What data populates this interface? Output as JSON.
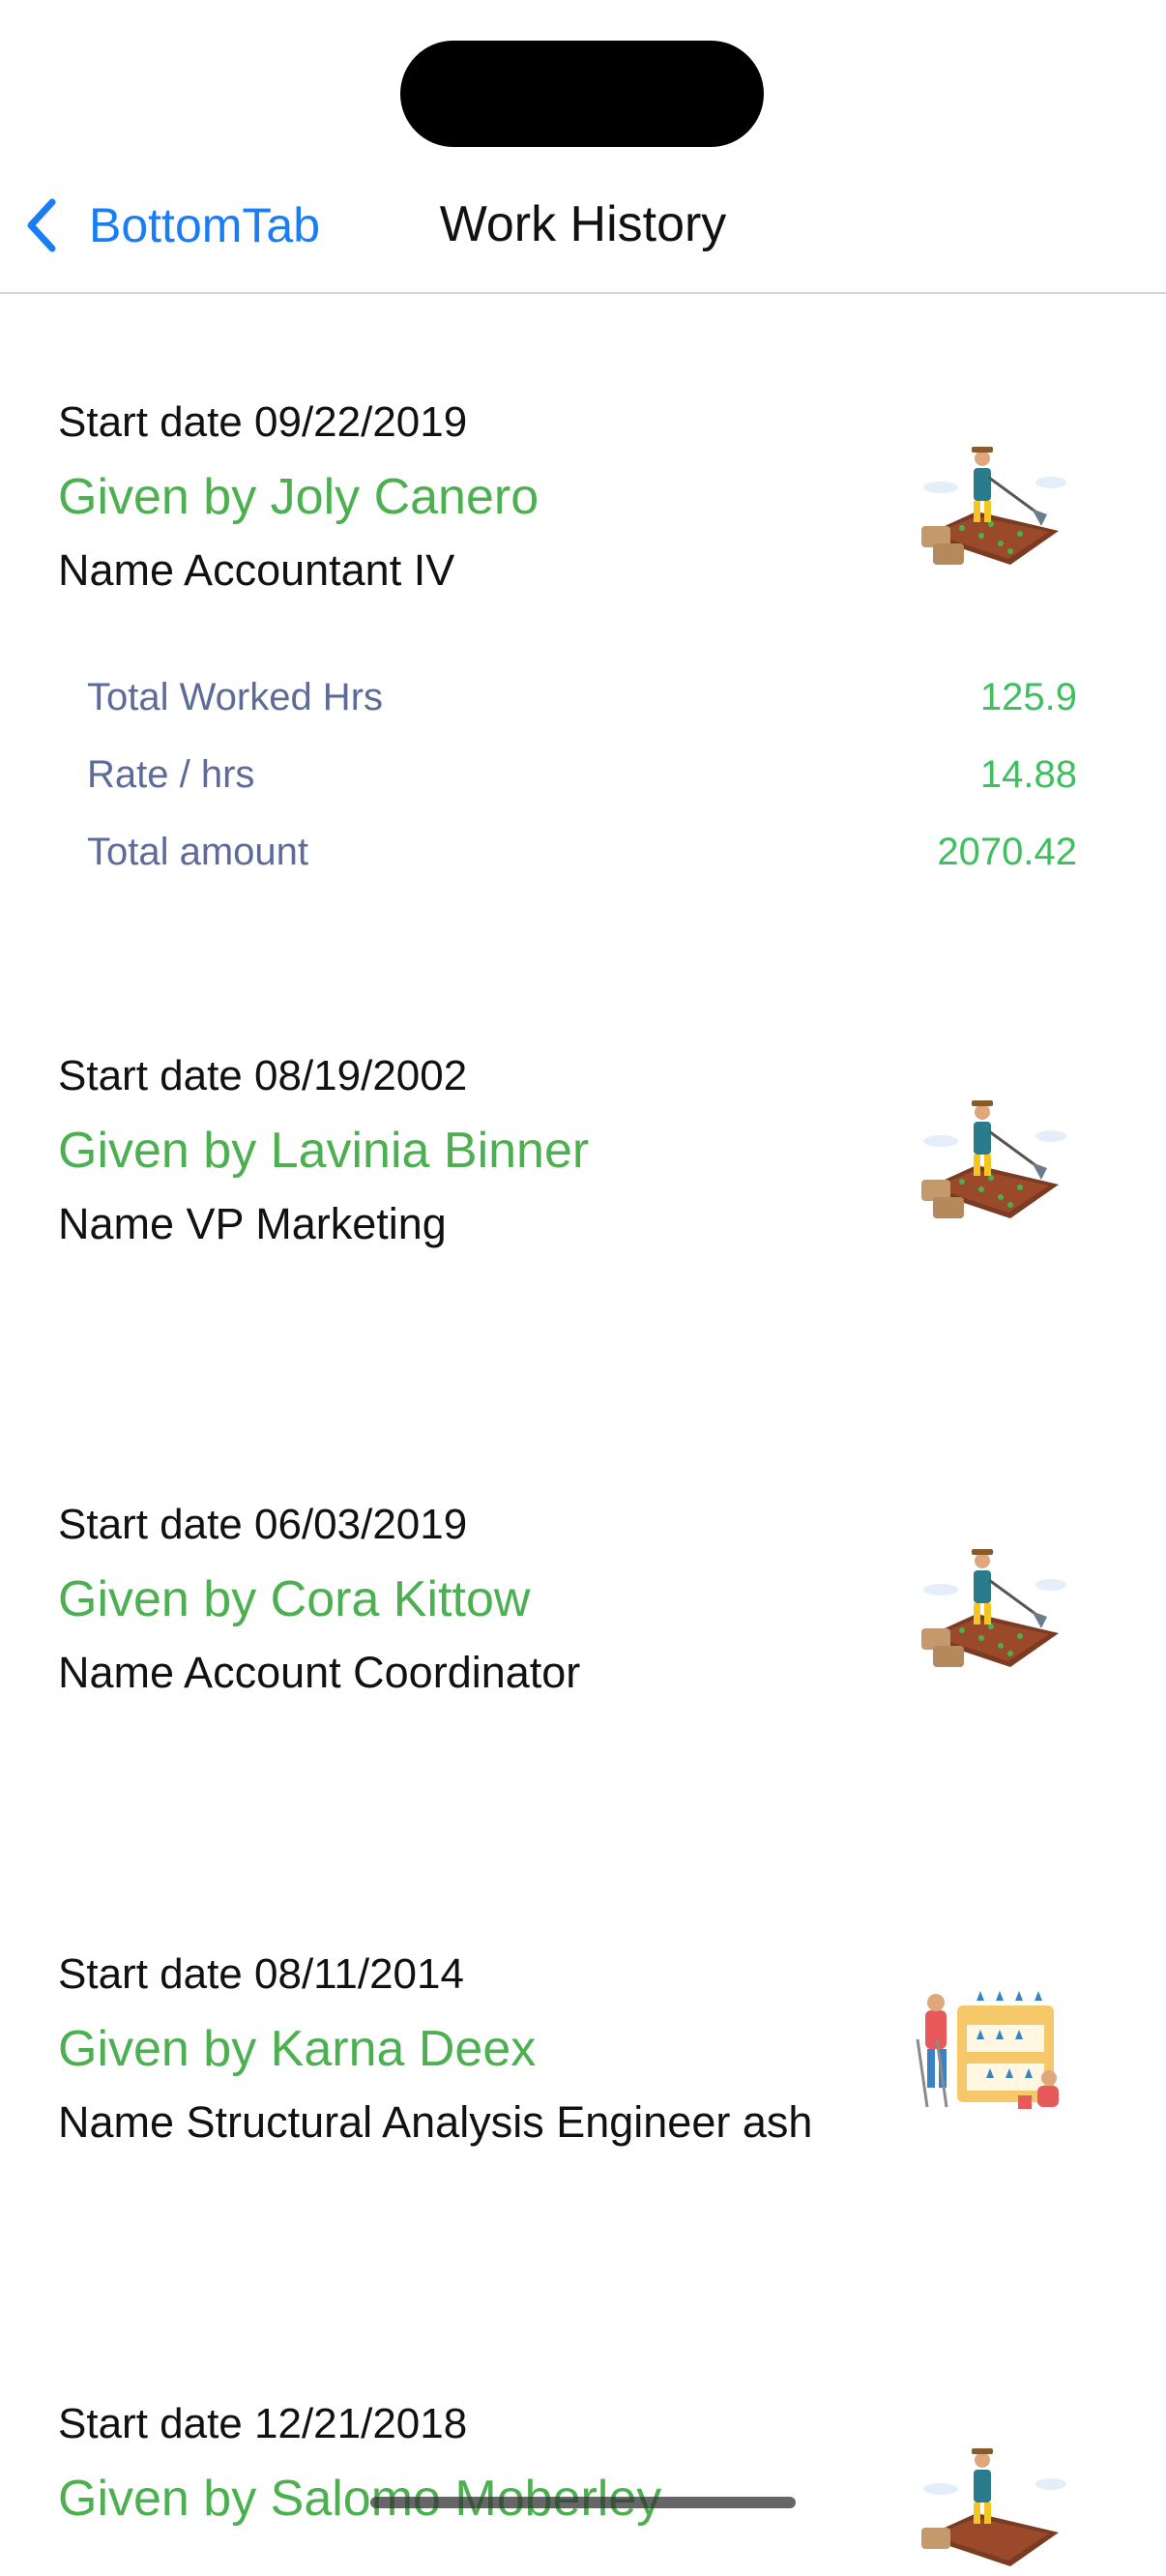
{
  "nav": {
    "back_label": "BottomTab",
    "title": "Work History"
  },
  "work_items": [
    {
      "start_date": "Start date 09/22/2019",
      "given_by": "Given by Joly Canero",
      "name": "Name Accountant IV",
      "image": "farmer-field-illustration",
      "stats": [
        {
          "label": "Total Worked Hrs",
          "value": "125.9"
        },
        {
          "label": "Rate / hrs",
          "value": "14.88"
        },
        {
          "label": "Total amount",
          "value": "2070.42"
        }
      ]
    },
    {
      "start_date": "Start date 08/19/2002",
      "given_by": "Given by Lavinia Binner",
      "name": "Name VP Marketing",
      "image": "farmer-field-illustration"
    },
    {
      "start_date": "Start date 06/03/2019",
      "given_by": "Given by Cora Kittow",
      "name": "Name Account Coordinator",
      "image": "farmer-field-illustration"
    },
    {
      "start_date": "Start date 08/11/2014",
      "given_by": "Given by Karna Deex",
      "name": "Name Structural Analysis Engineer ash",
      "image": "gardeners-shelf-illustration"
    },
    {
      "start_date": "Start date 12/21/2018",
      "given_by": "Given by Salomo Moberley",
      "name": "",
      "image": "farmer-field-illustration"
    }
  ],
  "colors": {
    "accent_blue": "#1a7ef2",
    "given_green": "#4caf50",
    "stat_label": "#5d6b9a",
    "stat_value": "#3fbf5f"
  }
}
